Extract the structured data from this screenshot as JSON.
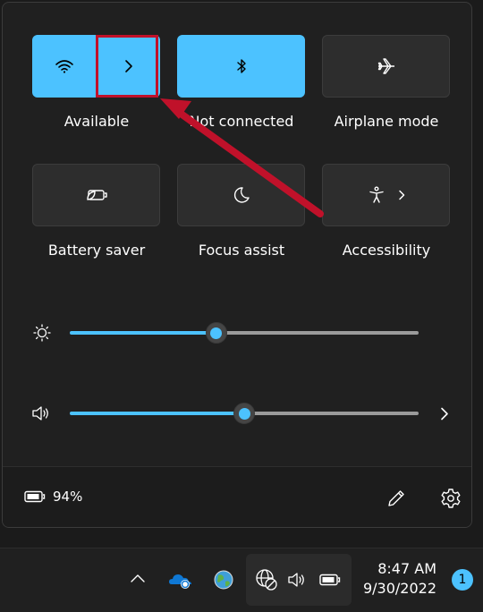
{
  "quick_settings": {
    "wifi": {
      "label": "Available",
      "state": "on"
    },
    "bluetooth": {
      "label": "Not connected",
      "state": "on"
    },
    "airplane": {
      "label": "Airplane mode",
      "state": "off"
    },
    "battery_saver": {
      "label": "Battery saver",
      "state": "off"
    },
    "focus_assist": {
      "label": "Focus assist",
      "state": "off"
    },
    "accessibility": {
      "label": "Accessibility",
      "state": "off"
    }
  },
  "sliders": {
    "brightness": {
      "value": 42
    },
    "volume": {
      "value": 50
    }
  },
  "footer": {
    "battery_percent": "94%"
  },
  "taskbar": {
    "time": "8:47 AM",
    "date": "9/30/2022",
    "notification_count": "1"
  },
  "colors": {
    "accent": "#4cc2ff",
    "annotation": "#c0112a"
  },
  "icons": [
    "wifi-icon",
    "chevron-right-icon",
    "bluetooth-icon",
    "airplane-icon",
    "battery-saver-icon",
    "moon-icon",
    "accessibility-icon",
    "brightness-icon",
    "speaker-icon",
    "battery-icon",
    "pencil-icon",
    "gear-icon",
    "chevron-up-icon",
    "onedrive-icon",
    "globe-icon",
    "network-blocked-icon"
  ]
}
